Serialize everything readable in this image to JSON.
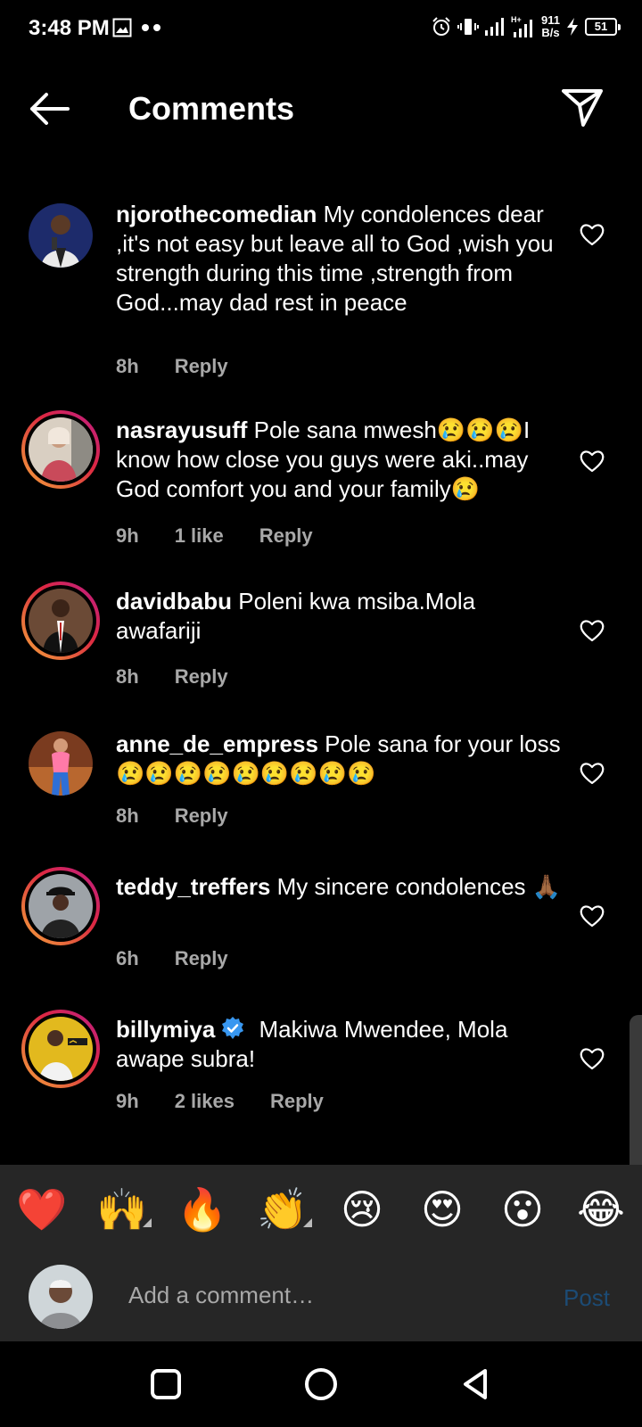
{
  "status_bar": {
    "time": "3:48 PM",
    "net_speed_value": "911",
    "net_speed_unit": "B/s",
    "battery": "51",
    "icons": [
      "image-icon",
      "dots-icon",
      "alarm-icon",
      "vibrate-icon",
      "signal-icon",
      "signal-hplus-icon",
      "charging-icon",
      "battery-icon"
    ]
  },
  "header": {
    "title": "Comments",
    "back_icon": "arrow-left-icon",
    "send_icon": "paper-plane-icon"
  },
  "comments": [
    {
      "username": "njorothecomedian",
      "text": "My condolences dear ,it's not easy but leave all to God ,wish you strength during this time ,strength from God...may dad rest in peace",
      "time": "8h",
      "likes": "",
      "reply": "Reply",
      "story_ring": false,
      "verified": false
    },
    {
      "username": "nasrayusuff",
      "text": "Pole sana mwesh😢😢😢I know how close you guys were aki..may God comfort you and your family😢",
      "time": "9h",
      "likes": "1 like",
      "reply": "Reply",
      "story_ring": true,
      "verified": false
    },
    {
      "username": "davidbabu",
      "text": "Poleni kwa msiba.Mola awafariji",
      "time": "8h",
      "likes": "",
      "reply": "Reply",
      "story_ring": true,
      "verified": false
    },
    {
      "username": "anne_de_empress",
      "text": "Pole sana for your loss😢😢😢😢😢😢😢😢😢",
      "time": "8h",
      "likes": "",
      "reply": "Reply",
      "story_ring": false,
      "verified": false
    },
    {
      "username": "teddy_treffers",
      "text": "My sincere condolences 🙏🏾",
      "time": "6h",
      "likes": "",
      "reply": "Reply",
      "story_ring": true,
      "verified": false
    },
    {
      "username": "billymiya",
      "text": "Makiwa Mwendee, Mola awape subra!",
      "time": "9h",
      "likes": "2 likes",
      "reply": "Reply",
      "story_ring": true,
      "verified": true
    }
  ],
  "emoji_bar": [
    "❤️",
    "🙌",
    "🔥",
    "👏",
    "😢",
    "😍",
    "😮",
    "😂"
  ],
  "composer": {
    "placeholder": "Add a comment…",
    "post_label": "Post"
  },
  "nav": [
    "square-icon",
    "circle-icon",
    "triangle-back-icon"
  ],
  "colors": {
    "background": "#000000",
    "secondary_text": "#a8a8a8",
    "post_disabled": "#1c4b75",
    "verified_blue": "#3897f0",
    "composer_bg": "#262626"
  }
}
